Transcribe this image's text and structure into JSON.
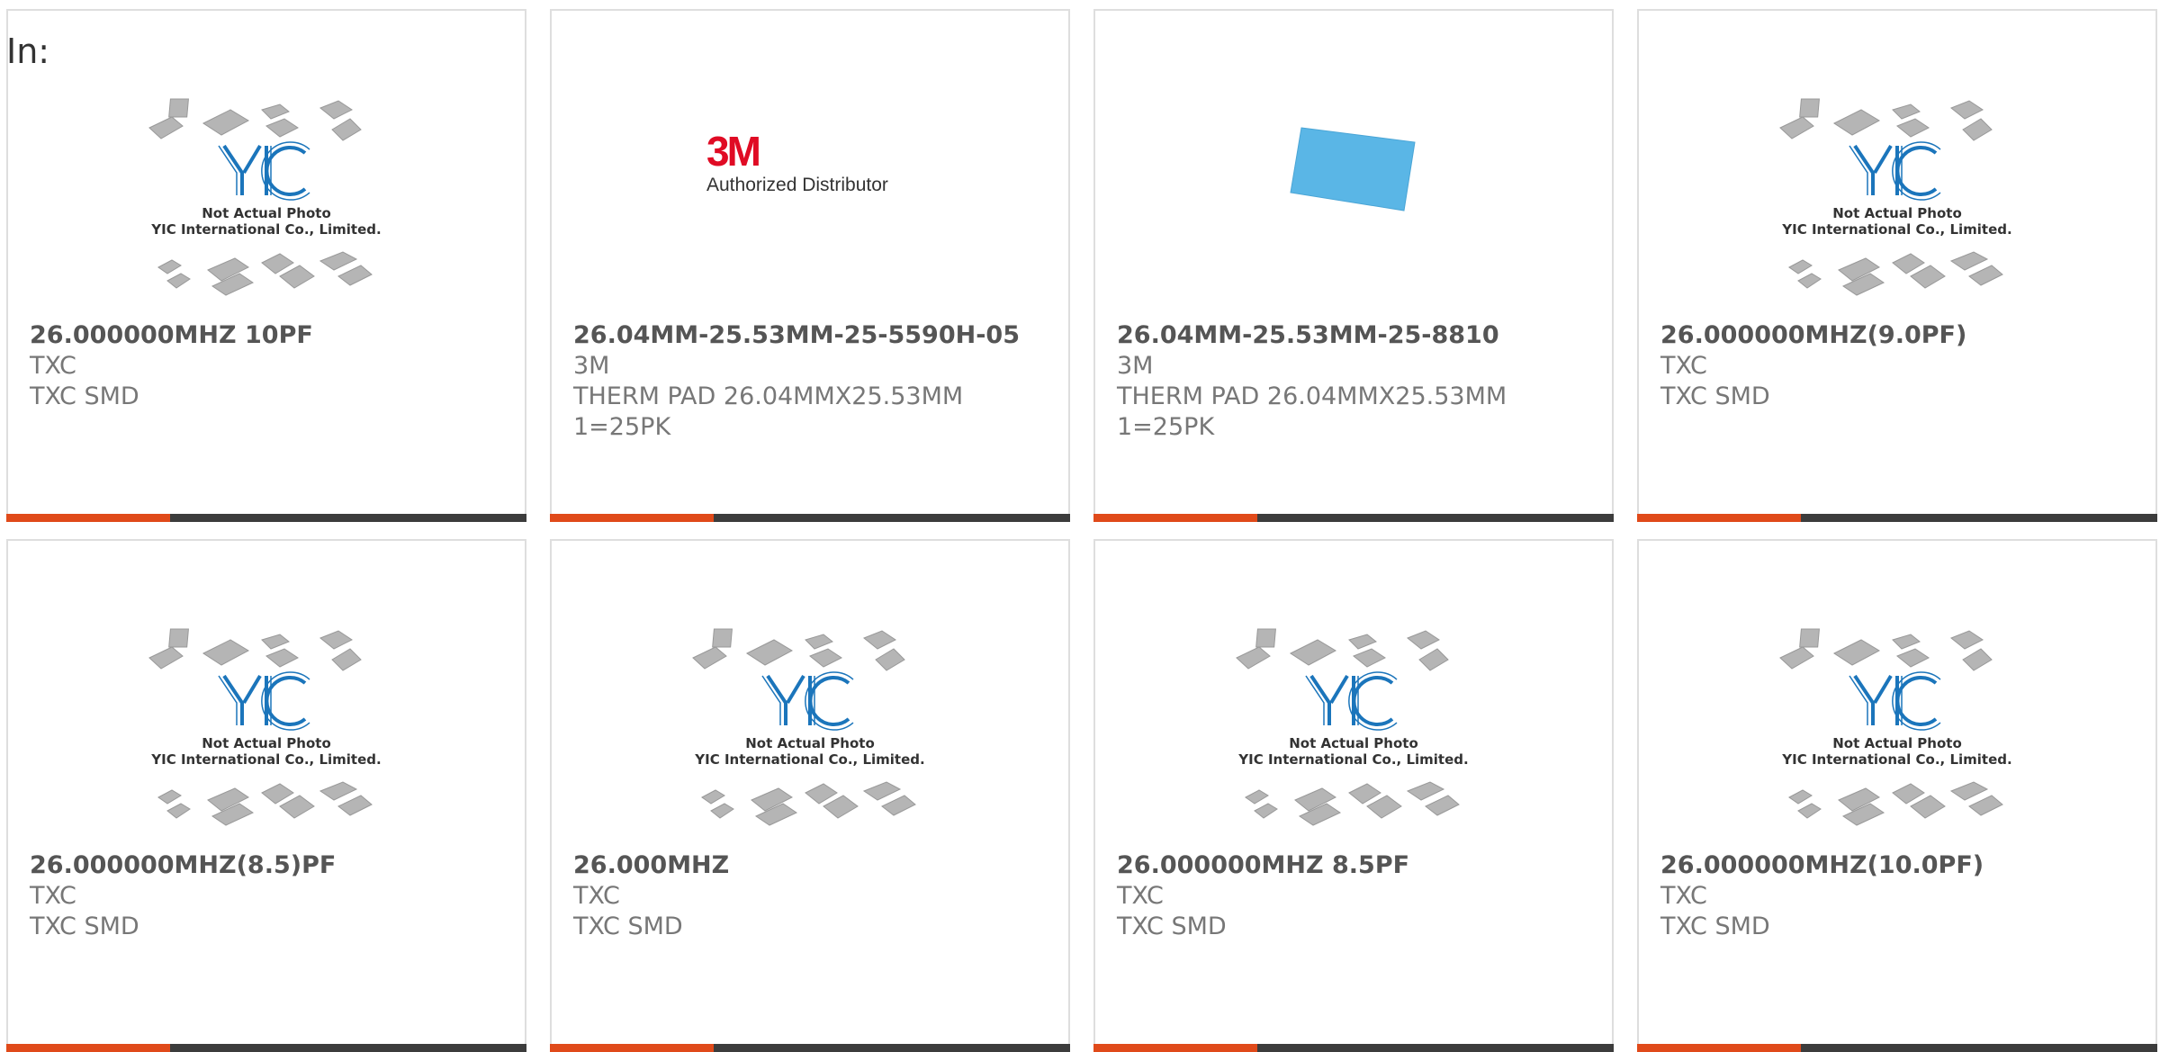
{
  "page_label": "In:",
  "placeholder_caption": {
    "line1": "Not Actual Photo",
    "line2": "YIC International Co., Limited.",
    "logo_text": "YIC"
  },
  "brand_logo": {
    "mark": "3M",
    "caption": "Authorized Distributor"
  },
  "colors": {
    "accent": "#e04a1a",
    "bar": "#3c3c3c",
    "yic_blue": "#1b75bb",
    "pad_blue": "#5ab6e6",
    "brand_red": "#e00b24"
  },
  "products": [
    {
      "part_number": "26.000000MHZ 10PF",
      "manufacturer": "TXC",
      "description": "TXC SMD",
      "image": "yic-placeholder"
    },
    {
      "part_number": "26.04MM-25.53MM-25-5590H-05",
      "manufacturer": "3M",
      "description": "THERM PAD 26.04MMX25.53MM 1=25PK",
      "image": "3m-logo"
    },
    {
      "part_number": "26.04MM-25.53MM-25-8810",
      "manufacturer": "3M",
      "description": "THERM PAD 26.04MMX25.53MM 1=25PK",
      "image": "blue-pad"
    },
    {
      "part_number": "26.000000MHZ(9.0PF)",
      "manufacturer": "TXC",
      "description": "TXC SMD",
      "image": "yic-placeholder"
    },
    {
      "part_number": "26.000000MHZ(8.5)PF",
      "manufacturer": "TXC",
      "description": "TXC SMD",
      "image": "yic-placeholder"
    },
    {
      "part_number": "26.000MHZ",
      "manufacturer": "TXC",
      "description": "TXC SMD",
      "image": "yic-placeholder"
    },
    {
      "part_number": "26.000000MHZ 8.5PF",
      "manufacturer": "TXC",
      "description": "TXC SMD",
      "image": "yic-placeholder"
    },
    {
      "part_number": "26.000000MHZ(10.0PF)",
      "manufacturer": "TXC",
      "description": "TXC SMD",
      "image": "yic-placeholder"
    }
  ]
}
